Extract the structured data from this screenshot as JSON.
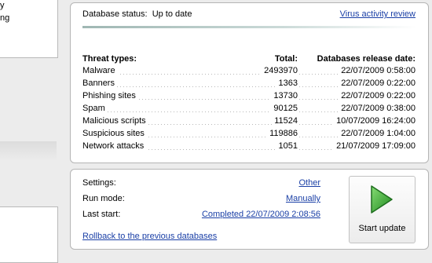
{
  "left_panel": {
    "lines": [
      "y",
      "ng"
    ]
  },
  "status": {
    "label": "Database status:",
    "value": "Up to date",
    "review_link": "Virus activity review"
  },
  "threats": {
    "headers": {
      "type": "Threat types:",
      "total": "Total:",
      "date": "Databases release date:"
    },
    "rows": [
      {
        "type": "Malware",
        "total": "2493970",
        "date": "22/07/2009 0:58:00"
      },
      {
        "type": "Banners",
        "total": "1363",
        "date": "22/07/2009 0:22:00"
      },
      {
        "type": "Phishing sites",
        "total": "13730",
        "date": "22/07/2009 0:22:00"
      },
      {
        "type": "Spam",
        "total": "90125",
        "date": "22/07/2009 0:38:00"
      },
      {
        "type": "Malicious scripts",
        "total": "11524",
        "date": "10/07/2009 16:24:00"
      },
      {
        "type": "Suspicious sites",
        "total": "119886",
        "date": "22/07/2009 1:04:00"
      },
      {
        "type": "Network attacks",
        "total": "1051",
        "date": "21/07/2009 17:09:00"
      }
    ]
  },
  "settings": {
    "settings_label": "Settings:",
    "settings_value": "Other",
    "run_mode_label": "Run mode:",
    "run_mode_value": "Manually",
    "last_start_label": "Last start:",
    "last_start_value": "Completed 22/07/2009 2:08:56",
    "rollback_link": "Rollback to the previous databases",
    "start_update_label": "Start update"
  },
  "colors": {
    "link": "#1a3fa6",
    "play_icon": "#2f9e2f"
  },
  "icons": {
    "start_update": "green-play-icon"
  }
}
